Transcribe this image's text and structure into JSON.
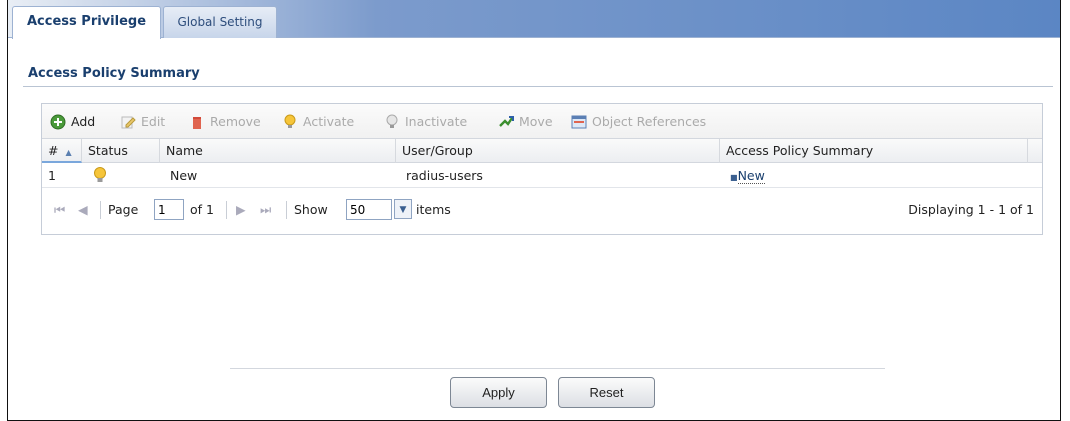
{
  "tabs": [
    {
      "label": "Access Privilege"
    },
    {
      "label": "Global Setting"
    }
  ],
  "section": {
    "title": "Access Policy Summary"
  },
  "toolbar": {
    "add": "Add",
    "edit": "Edit",
    "remove": "Remove",
    "activate": "Activate",
    "inactivate": "Inactivate",
    "move": "Move",
    "object_references": "Object References"
  },
  "table": {
    "headers": [
      "#",
      "Status",
      "Name",
      "User/Group",
      "Access Policy Summary"
    ],
    "rows": [
      {
        "index": "1",
        "status": "lightbulb-on",
        "name": "New",
        "user_group": "radius-users",
        "policy": "New"
      }
    ]
  },
  "pager": {
    "page_label": "Page",
    "page_value": "1",
    "of_label": "of 1",
    "show_label": "Show",
    "show_value": "50",
    "items_label": "items",
    "displaying": "Displaying 1 - 1 of 1"
  },
  "buttons": {
    "apply": "Apply",
    "reset": "Reset"
  },
  "colors": {
    "accent": "#1a3f6e",
    "header_blue": "#5b86c4"
  }
}
